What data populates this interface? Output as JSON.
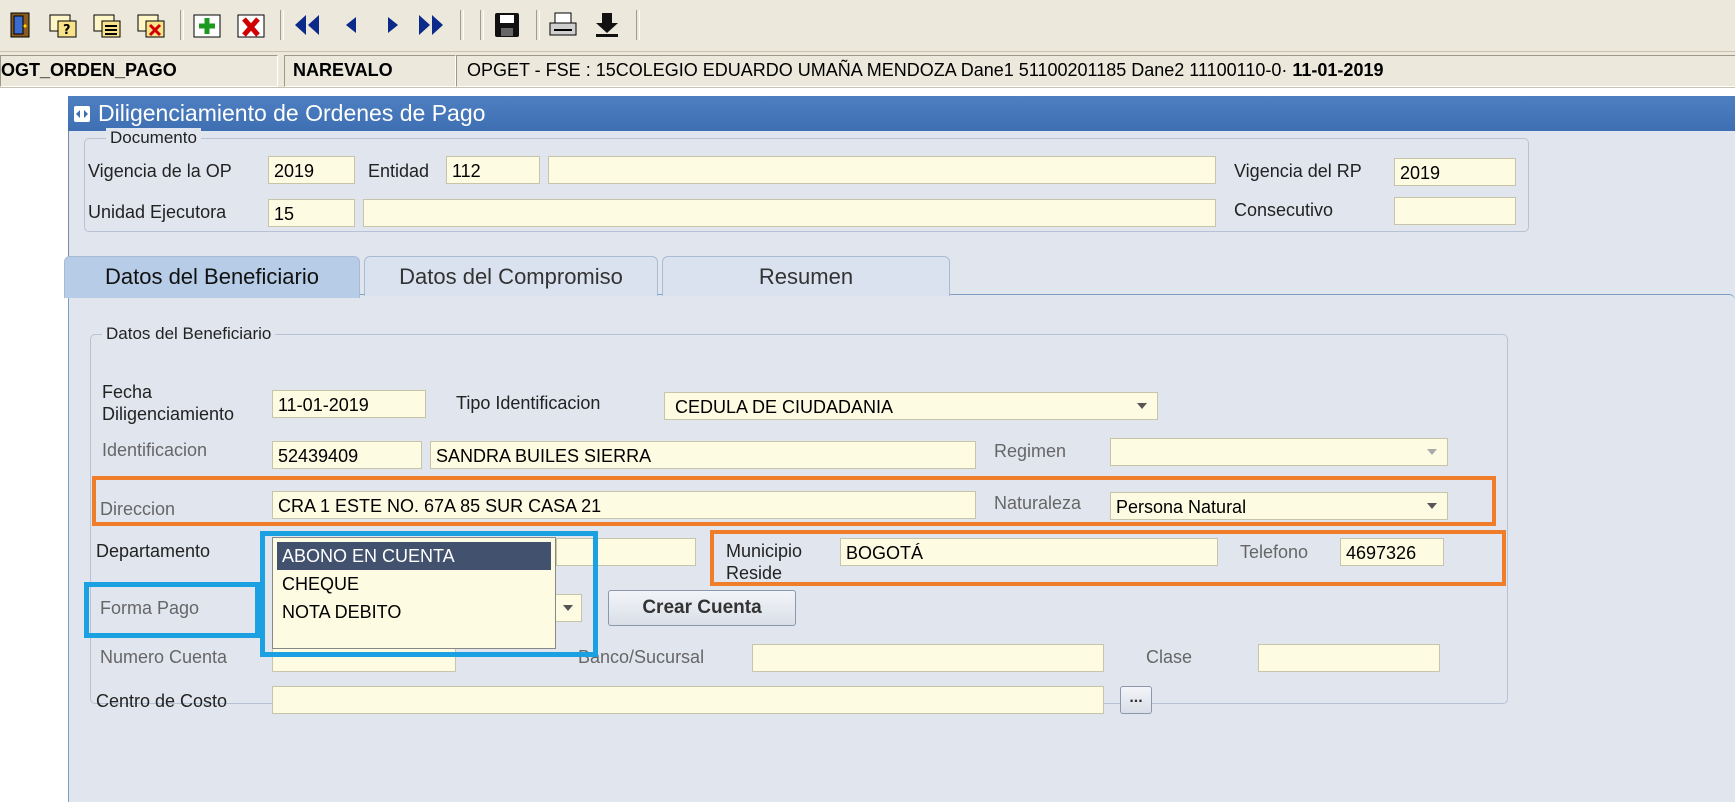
{
  "toolbar": {
    "icons": [
      "exit-door-icon",
      "help-query-icon",
      "enter-query-icon",
      "cancel-query-icon",
      "insert-record-icon",
      "delete-record-icon",
      "first-record-icon",
      "previous-record-icon",
      "next-record-icon",
      "last-record-icon",
      "save-icon",
      "print-icon",
      "download-icon"
    ]
  },
  "status": {
    "form_name": "OGT_ORDEN_PAGO",
    "user": "NAREVALO",
    "context": "OPGET - FSE : 15COLEGIO EDUARDO UMAÑA MENDOZA Dane1 51100201185 Dane2 11100110",
    "context_suffix": "-0·",
    "date": "11-01-2019"
  },
  "window": {
    "title": "Diligenciamiento de Ordenes de Pago"
  },
  "documento": {
    "legend": "Documento",
    "vigencia_op_label": "Vigencia de la OP",
    "vigencia_op_value": "2019",
    "entidad_label": "Entidad",
    "entidad_value": "112",
    "entidad_name": "",
    "vigencia_rp_label": "Vigencia del RP",
    "vigencia_rp_value": "2019",
    "unidad_label": "Unidad Ejecutora",
    "unidad_value": "15",
    "unidad_name": "",
    "consecutivo_label": "Consecutivo",
    "consecutivo_value": ""
  },
  "tabs": [
    {
      "label": "Datos del Beneficiario",
      "active": true
    },
    {
      "label": "Datos del Compromiso",
      "active": false
    },
    {
      "label": "Resumen",
      "active": false
    }
  ],
  "beneficiario": {
    "legend": "Datos del Beneficiario",
    "fecha_label_1": "Fecha",
    "fecha_label_2": "Diligenciamiento",
    "fecha_value": "11-01-2019",
    "tipo_id_label": "Tipo Identificacion",
    "tipo_id_value": "CEDULA DE CIUDADANIA",
    "identificacion_label": "Identificacion",
    "identificacion_value": "52439409",
    "nombre_value": "SANDRA  BUILES SIERRA",
    "regimen_label": "Regimen",
    "regimen_value": "",
    "direccion_label": "Direccion",
    "direccion_value": "CRA 1 ESTE NO. 67A 85 SUR CASA 21",
    "naturaleza_label": "Naturaleza",
    "naturaleza_value": "Persona Natural",
    "departamento_label": "Departamento",
    "departamento_value": "",
    "municipio_label_1": "Municipio",
    "municipio_label_2": "Reside",
    "municipio_value": "BOGOTÁ",
    "telefono_label": "Telefono",
    "telefono_value": "4697326",
    "forma_pago_label": "Forma Pago",
    "forma_pago_options": [
      "ABONO EN CUENTA",
      "CHEQUE",
      "NOTA DEBITO"
    ],
    "forma_pago_selected": "ABONO EN CUENTA",
    "crear_cuenta_label": "Crear Cuenta",
    "numero_cuenta_label": "Numero Cuenta",
    "numero_cuenta_value": "",
    "banco_label": "Banco/Sucursal",
    "banco_value": "",
    "clase_label": "Clase",
    "clase_value": "",
    "centro_costo_label": "Centro de Costo",
    "centro_costo_value": "",
    "ellipsis_label": "..."
  },
  "colors": {
    "highlight_orange": "#f07d2a",
    "highlight_blue": "#1ba1e2",
    "title_bar": "#3f6fb3",
    "field_bg": "#fdfbe2"
  }
}
